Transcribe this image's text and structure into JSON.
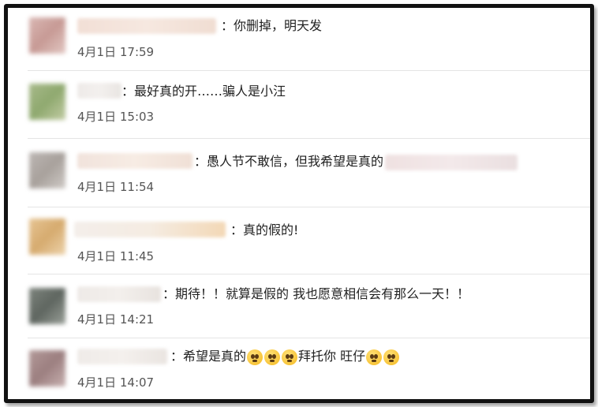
{
  "comments": [
    {
      "text": "：你删掉，明天发",
      "time": "4月1日 17:59"
    },
    {
      "text": "：最好真的开……骗人是小汪",
      "time": "4月1日 15:03"
    },
    {
      "text": "：愚人节不敢信，但我希望是真的",
      "time": "4月1日 11:54"
    },
    {
      "text": "：真的假的!",
      "time": "4月1日 11:45"
    },
    {
      "text": "：期待！！就算是假的 我也愿意相信会有那么一天！！",
      "time": "4月1日 14:21"
    },
    {
      "text_a": "：希望是真的",
      "text_b": "拜托你 旺仔",
      "time": "4月1日 14:07"
    }
  ],
  "emoji_icon": "pleading-face-emoji"
}
